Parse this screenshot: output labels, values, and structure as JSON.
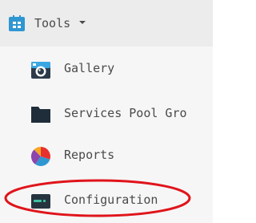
{
  "menu": {
    "title": "Tools",
    "header_icon": "grid-app-icon",
    "caret_icon": "caret-down-icon",
    "items": [
      {
        "label": "Gallery",
        "icon": "camera-icon"
      },
      {
        "label": "Services Pool Gro",
        "icon": "folder-icon"
      },
      {
        "label": "Reports",
        "icon": "pie-chart-icon"
      },
      {
        "label": "Configuration",
        "icon": "server-icon"
      }
    ],
    "highlight_color": "#e0141b"
  },
  "colors": {
    "header_bg": "#ececec",
    "submenu_bg": "#f6f6f6",
    "text": "#4a4a4a",
    "accent": "#2f96d1"
  }
}
